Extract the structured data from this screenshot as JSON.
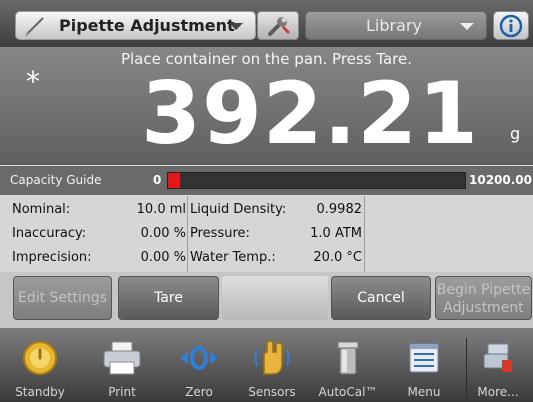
{
  "topbar": {
    "application": "Pipette Adjustment",
    "library": "Library"
  },
  "display": {
    "instruction": "Place container on the pan.  Press Tare.",
    "stable_indicator": "*",
    "weight": "392.21",
    "unit": "g"
  },
  "capacity_guide": {
    "label": "Capacity Guide",
    "min": "0",
    "max": "10200.00",
    "fill_fraction": 0.04,
    "fill_color": "#e3181b"
  },
  "info": {
    "rows": [
      {
        "label": "Nominal:",
        "value": "10.0 ml",
        "label2": "Liquid Density:",
        "value2": "0.9982"
      },
      {
        "label": "Inaccuracy:",
        "value": "0.00 %",
        "label2": "Pressure:",
        "value2": "1.0 ATM"
      },
      {
        "label": "Imprecision:",
        "value": "0.00 %",
        "label2": "Water Temp.:",
        "value2": "20.0 °C"
      }
    ]
  },
  "actions": {
    "edit_settings": "Edit Settings",
    "tare": "Tare",
    "cancel": "Cancel",
    "begin_line1": "Begin Pipette",
    "begin_line2": "Adjustment"
  },
  "bottombar": {
    "items": [
      {
        "label": "Standby",
        "icon": "standby-icon"
      },
      {
        "label": "Print",
        "icon": "printer-icon"
      },
      {
        "label": "Zero",
        "icon": "zero-icon"
      },
      {
        "label": "Sensors",
        "icon": "sensors-hand-icon"
      },
      {
        "label": "AutoCal™",
        "icon": "calibration-weight-icon"
      },
      {
        "label": "Menu",
        "icon": "menu-icon"
      },
      {
        "label": "More...",
        "icon": "more-icon"
      }
    ]
  }
}
